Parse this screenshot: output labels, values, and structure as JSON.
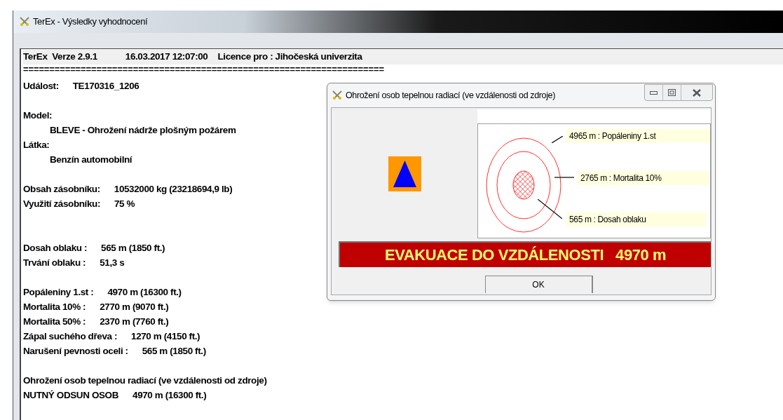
{
  "window": {
    "title": "TerEx - Výsledky vyhodnocení"
  },
  "report": {
    "header": [
      "TerEx  Verze 2.9.1",
      "16.03.2017 12:07:00",
      "Licence pro : Jihočeská univerzita"
    ],
    "separator": "=====================================================================",
    "lines": [
      {
        "kind": "pair",
        "label": "Událost:",
        "value": "TE170316_1206"
      },
      {
        "kind": "gap"
      },
      {
        "kind": "text",
        "text": "Model:"
      },
      {
        "kind": "indent",
        "text": "BLEVE - Ohrožení nádrže plošným požárem"
      },
      {
        "kind": "text",
        "text": "Látka:"
      },
      {
        "kind": "indent",
        "text": "Benzín automobilní"
      },
      {
        "kind": "gap"
      },
      {
        "kind": "pair",
        "label": "Obsah zásobníku:",
        "value": "10532000 kg (23218694,9 lb)"
      },
      {
        "kind": "pair",
        "label": "Využití zásobníku:",
        "value": "75 %"
      },
      {
        "kind": "gap"
      },
      {
        "kind": "gap"
      },
      {
        "kind": "pair",
        "label": "Dosah oblaku :",
        "value": "565 m (1850 ft.)"
      },
      {
        "kind": "pair",
        "label": "Trvání oblaku :",
        "value": "51,3 s"
      },
      {
        "kind": "gap"
      },
      {
        "kind": "pair",
        "label": "Popáleniny 1.st :",
        "value": "4970 m (16300 ft.)"
      },
      {
        "kind": "pair",
        "label": "Mortalita 10% :",
        "value": "2770 m (9070 ft.)"
      },
      {
        "kind": "pair",
        "label": "Mortalita 50% :",
        "value": "2370 m (7760 ft.)"
      },
      {
        "kind": "pair",
        "label": "Zápal suchého dřeva :",
        "value": "1270 m (4150 ft.)"
      },
      {
        "kind": "pair",
        "label": "Narušení pevnosti oceli :",
        "value": "565 m (1850 ft.)"
      },
      {
        "kind": "gap"
      },
      {
        "kind": "text",
        "text": "Ohrožení osob tepelnou radiací (ve vzdálenosti od zdroje)"
      },
      {
        "kind": "pair",
        "label": "NUTNÝ ODSUN OSOB",
        "value": "4970 m (16300 ft.)"
      }
    ]
  },
  "dialog": {
    "title": "Ohrožení osob tepelnou radiací (ve vzdálenosti od zdroje)",
    "diagram": {
      "labels": [
        "4965 m : Popáleniny 1.st",
        "2765 m : Mortalita 10%",
        "565 m : Dosah oblaku"
      ]
    },
    "banner": "EVAKUACE DO VZDÁLENOSTI   4970 m",
    "button": "OK"
  }
}
